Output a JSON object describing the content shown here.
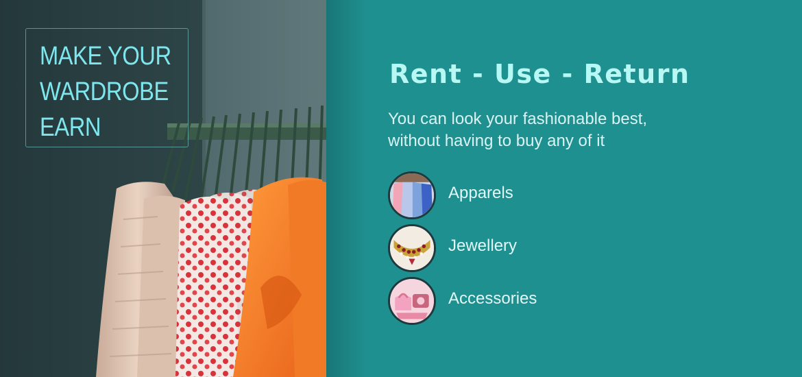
{
  "tagline": {
    "lines": [
      "MAKE YOUR",
      "WARDROBE",
      "EARN"
    ]
  },
  "headline": "Rent - Use - Return",
  "subtitle": "You can look your fashionable best, without having to buy any of it",
  "categories": [
    {
      "label": "Apparels",
      "icon": "apparels-thumbnail"
    },
    {
      "label": "Jewellery",
      "icon": "jewellery-thumbnail"
    },
    {
      "label": "Accessories",
      "icon": "accessories-thumbnail"
    }
  ],
  "colors": {
    "background": "#1f9090",
    "tagline_text": "#7ee6ec",
    "headline_text": "#b7f7f4",
    "body_text": "#d9f3f2"
  }
}
